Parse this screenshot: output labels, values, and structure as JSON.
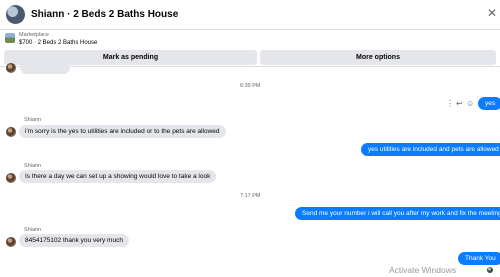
{
  "header": {
    "title": "Shiann · 2 Beds 2 Baths House",
    "close_glyph": "✕"
  },
  "marketplace": {
    "label": "Marketplace",
    "listing": "$700 · 2 Beds 2 Baths House"
  },
  "actions": {
    "mark_pending": "Mark as pending",
    "more_options": "More options"
  },
  "timestamps": {
    "first": "6:39 PM",
    "second": "7:17 PM"
  },
  "sender_name": "Shiann",
  "messages": {
    "in_1": "i'm sorry is the yes to utilities are included or to the pets are allowed",
    "in_2": "Is there a day we can set up a showing would love to take a look",
    "in_3": "8454175102 thank you very much",
    "out_1": "yes",
    "out_2": "yes utilities are included and pets are allowed",
    "out_3": "Send me your number i will call you after my work and fix the meeting",
    "out_4": "Thank You"
  },
  "message_actions": {
    "more": "⋮",
    "reply": "↩",
    "react": "☺"
  },
  "watermark": "Activate Windows",
  "colors": {
    "outgoing": "#0a7cff",
    "incoming": "#e4e6eb"
  }
}
